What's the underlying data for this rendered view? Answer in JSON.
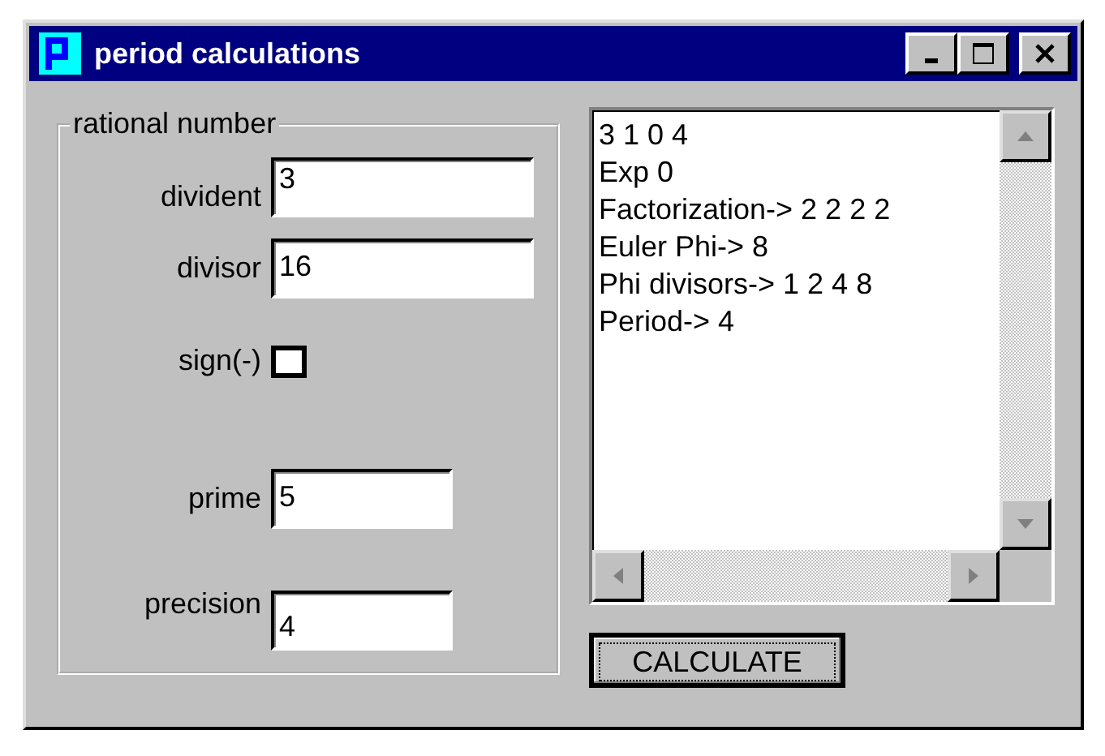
{
  "window": {
    "title": "period calculations"
  },
  "group": {
    "label": "rational number",
    "fields": [
      {
        "label": "divident",
        "value": "3"
      },
      {
        "label": "divisor",
        "value": "16"
      }
    ],
    "sign": {
      "label": "sign(-)",
      "checked": false
    },
    "lower_fields": [
      {
        "label": "prime",
        "value": "5"
      },
      {
        "label": "precision",
        "value": "4"
      }
    ]
  },
  "output": {
    "lines": [
      "3 1 0 4",
      "Exp 0",
      "Factorization-> 2 2 2 2",
      "Euler Phi-> 8",
      "Phi divisors-> 1 2 4 8",
      "Period-> 4"
    ]
  },
  "button": {
    "label": "CALCULATE"
  }
}
